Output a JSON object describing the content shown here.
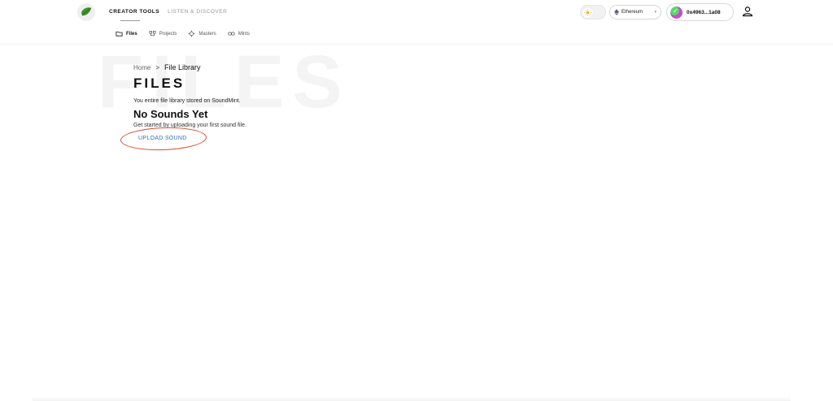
{
  "header": {
    "top_nav": [
      {
        "label": "CREATOR TOOLS",
        "active": true
      },
      {
        "label": "LISTEN & DISCOVER",
        "active": false
      }
    ],
    "sub_nav": [
      {
        "label": "Files",
        "icon": "folder-icon",
        "active": true
      },
      {
        "label": "Projects",
        "icon": "projects-icon",
        "active": false
      },
      {
        "label": "Masters",
        "icon": "masters-icon",
        "active": false
      },
      {
        "label": "Mints",
        "icon": "link-icon",
        "active": false
      }
    ],
    "network": {
      "label": "Ethereum",
      "icon": "ethereum-icon"
    },
    "wallet": {
      "address": "0x4963...1a08"
    }
  },
  "main": {
    "background_word": "FILES",
    "breadcrumb": {
      "home": "Home",
      "separator": ">",
      "current": "File Library"
    },
    "title": "FILES",
    "subtitle": "You entire file library stored on SoundMint.",
    "empty_title": "No Sounds Yet",
    "empty_text": "Get started by uploading your first sound file.",
    "upload_label": "UPLOAD SOUND"
  },
  "colors": {
    "brand_green": "#3f8f2f",
    "link_blue": "#2f6fb8",
    "annotation_red": "#d94b2b"
  }
}
